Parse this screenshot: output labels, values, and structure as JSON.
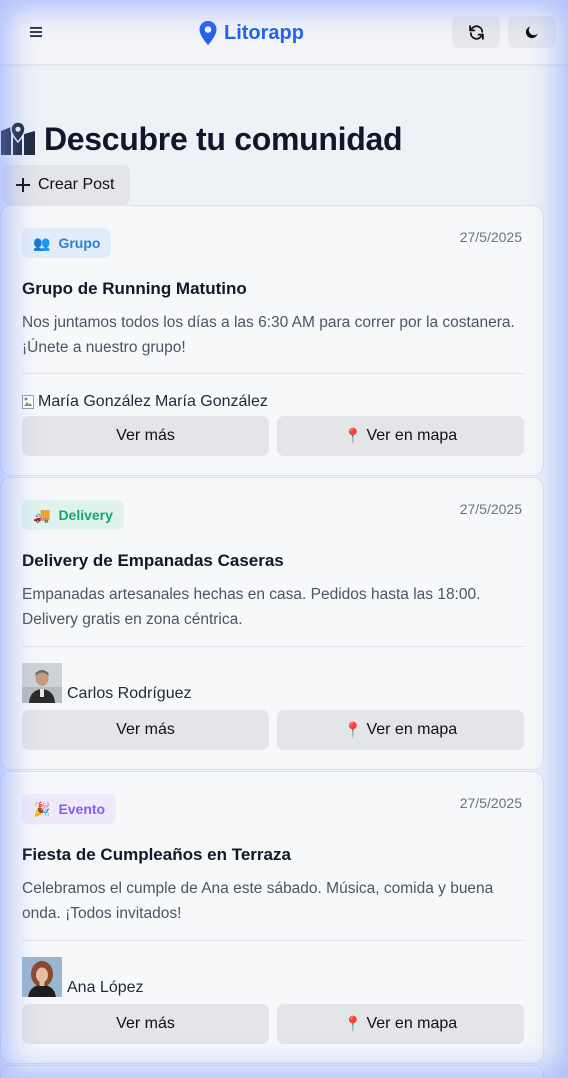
{
  "header": {
    "menu_icon": "menu-icon",
    "brand_icon": "map-pin-icon",
    "brand_color": "#2563eb",
    "brand": "Litorapp",
    "refresh_icon": "refresh-icon",
    "theme_icon": "moon-icon"
  },
  "page": {
    "title_icon": "map-icon",
    "title": "Descubre tu comunidad",
    "create_label": "Crear Post"
  },
  "colors": {
    "grupo": "#2b7fd6",
    "delivery": "#16a37b",
    "evento": "#8b5cf6"
  },
  "posts": [
    {
      "badge_emoji": "👥",
      "badge": "Grupo",
      "date": "27/5/2025",
      "title": "Grupo de Running Matutino",
      "description": "Nos juntamos todos los días a las 6:30 AM para correr por la costanera. ¡Únete a nuestro grupo!",
      "author_alt": "María González",
      "author": "María González",
      "more_label": "Ver más",
      "map_label": "Ver en mapa"
    },
    {
      "badge_emoji": "🚚",
      "badge": "Delivery",
      "date": "27/5/2025",
      "title": "Delivery de Empanadas Caseras",
      "description": "Empanadas artesanales hechas en casa. Pedidos hasta las 18:00. Delivery gratis en zona céntrica.",
      "author": "Carlos Rodríguez",
      "more_label": "Ver más",
      "map_label": "Ver en mapa"
    },
    {
      "badge_emoji": "🎉",
      "badge": "Evento",
      "date": "27/5/2025",
      "title": "Fiesta de Cumpleaños en Terraza",
      "description": "Celebramos el cumple de Ana este sábado. Música, comida y buena onda. ¡Todos invitados!",
      "author": "Ana López",
      "more_label": "Ver más",
      "map_label": "Ver en mapa"
    }
  ]
}
